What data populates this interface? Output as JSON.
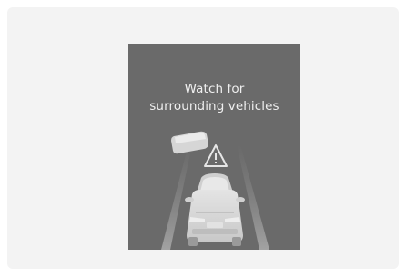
{
  "alert": {
    "line1": "Watch for",
    "line2": "surrounding vehicles"
  },
  "icons": {
    "warning": "warning-triangle-icon",
    "own_vehicle": "ego-car-icon",
    "surrounding_vehicle": "surrounding-vehicle-icon"
  },
  "colors": {
    "screen_background": "#6a6a6a",
    "text": "#efefef",
    "lane_lines": "#9a9a9a",
    "vehicle": "#d9d9d9"
  }
}
